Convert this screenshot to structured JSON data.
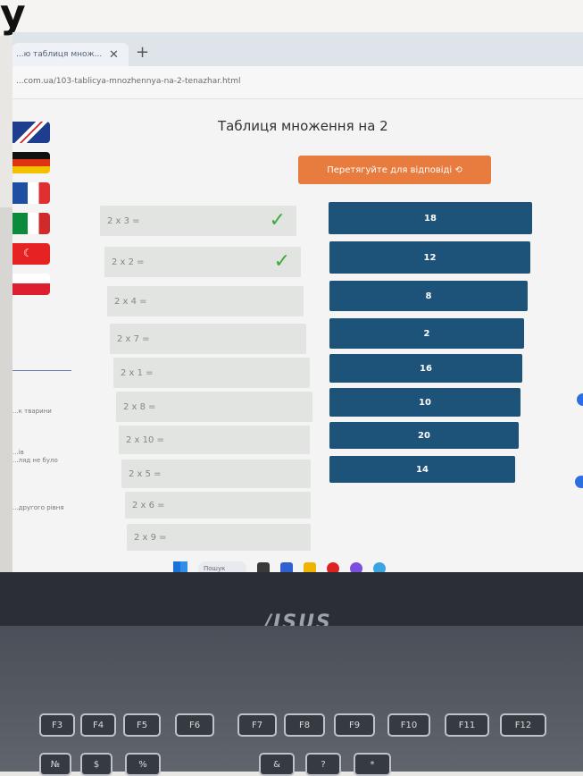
{
  "heading_fragment": "у",
  "browser": {
    "tab_title": "...ю таблиця множ...",
    "tab_close": "✕",
    "new_tab": "+",
    "url": "...com.ua/103-tablicya-mnozhennya-na-2-tenazhar.html"
  },
  "page": {
    "title": "Таблиця множення на 2",
    "hint_button": "Перетягуйте для відповіді ⟲"
  },
  "questions": [
    {
      "text": "2 x 3 =",
      "checked": true
    },
    {
      "text": "2 x 2 =",
      "checked": true
    },
    {
      "text": "2 x 4 =",
      "checked": false
    },
    {
      "text": "2 x 7 =",
      "checked": false
    },
    {
      "text": "2 x 1 =",
      "checked": false
    },
    {
      "text": "2 x 8 =",
      "checked": false
    },
    {
      "text": "2 x 10 =",
      "checked": false
    },
    {
      "text": "2 x 5 =",
      "checked": false
    },
    {
      "text": "2 x 6 =",
      "checked": false
    },
    {
      "text": "2 x 9 =",
      "checked": false
    }
  ],
  "answers": [
    "18",
    "12",
    "8",
    "2",
    "16",
    "10",
    "20",
    "14"
  ],
  "check_mark": "✓",
  "sidebar_text": [
    "...к тварини",
    "...ів\n...ляд не було",
    "...другого рівня"
  ],
  "taskbar": {
    "search": "Пошук"
  },
  "laptop": {
    "brand": "/ISUS"
  },
  "keys": [
    "F3",
    "F4",
    "F5",
    "F6",
    "F7",
    "F8",
    "F9",
    "F10",
    "F11",
    "F12",
    "№",
    "$",
    "%",
    "&",
    "?",
    "*"
  ]
}
